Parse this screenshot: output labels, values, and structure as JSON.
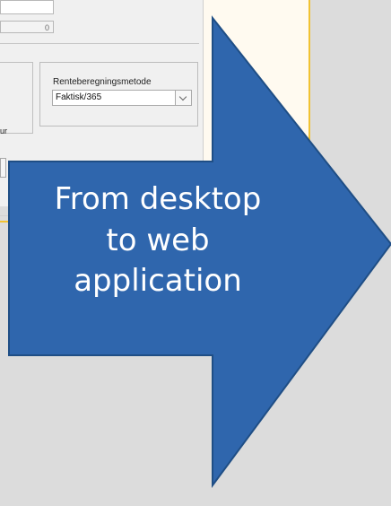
{
  "desktop_fragment": {
    "numeric_field": "0",
    "interest_method_label": "Renteberegningsmetode",
    "interest_method_value": "Faktisk/365",
    "partial_label": "ur"
  },
  "callout": {
    "text": "From desktop\nto web\napplication",
    "fill": "#2f66ad",
    "stroke": "#1f4e85"
  }
}
